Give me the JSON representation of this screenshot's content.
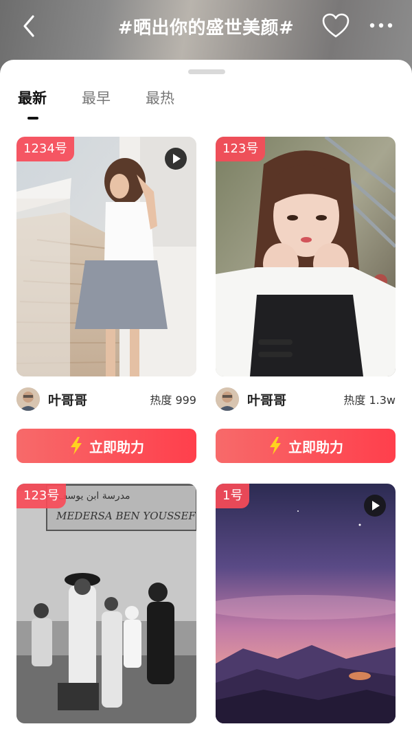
{
  "header": {
    "title": "#晒出你的盛世美颜#"
  },
  "tabs": [
    {
      "label": "最新",
      "active": true
    },
    {
      "label": "最早",
      "active": false
    },
    {
      "label": "最热",
      "active": false
    }
  ],
  "cards": [
    {
      "rank": "1234号",
      "has_video": true,
      "user": "叶哥哥",
      "heat": "热度 999",
      "button": "立即助力"
    },
    {
      "rank": "123号",
      "has_video": false,
      "user": "叶哥哥",
      "heat": "热度 1.3w",
      "button": "立即助力"
    },
    {
      "rank": "123号",
      "has_video": false,
      "sign_text": "MEDERSA BEN YOUSSEF"
    },
    {
      "rank": "1号",
      "has_video": true
    }
  ],
  "colors": {
    "accent": "#ff4a55",
    "badge": "#f74b58",
    "lightning": "#ffd21f"
  }
}
